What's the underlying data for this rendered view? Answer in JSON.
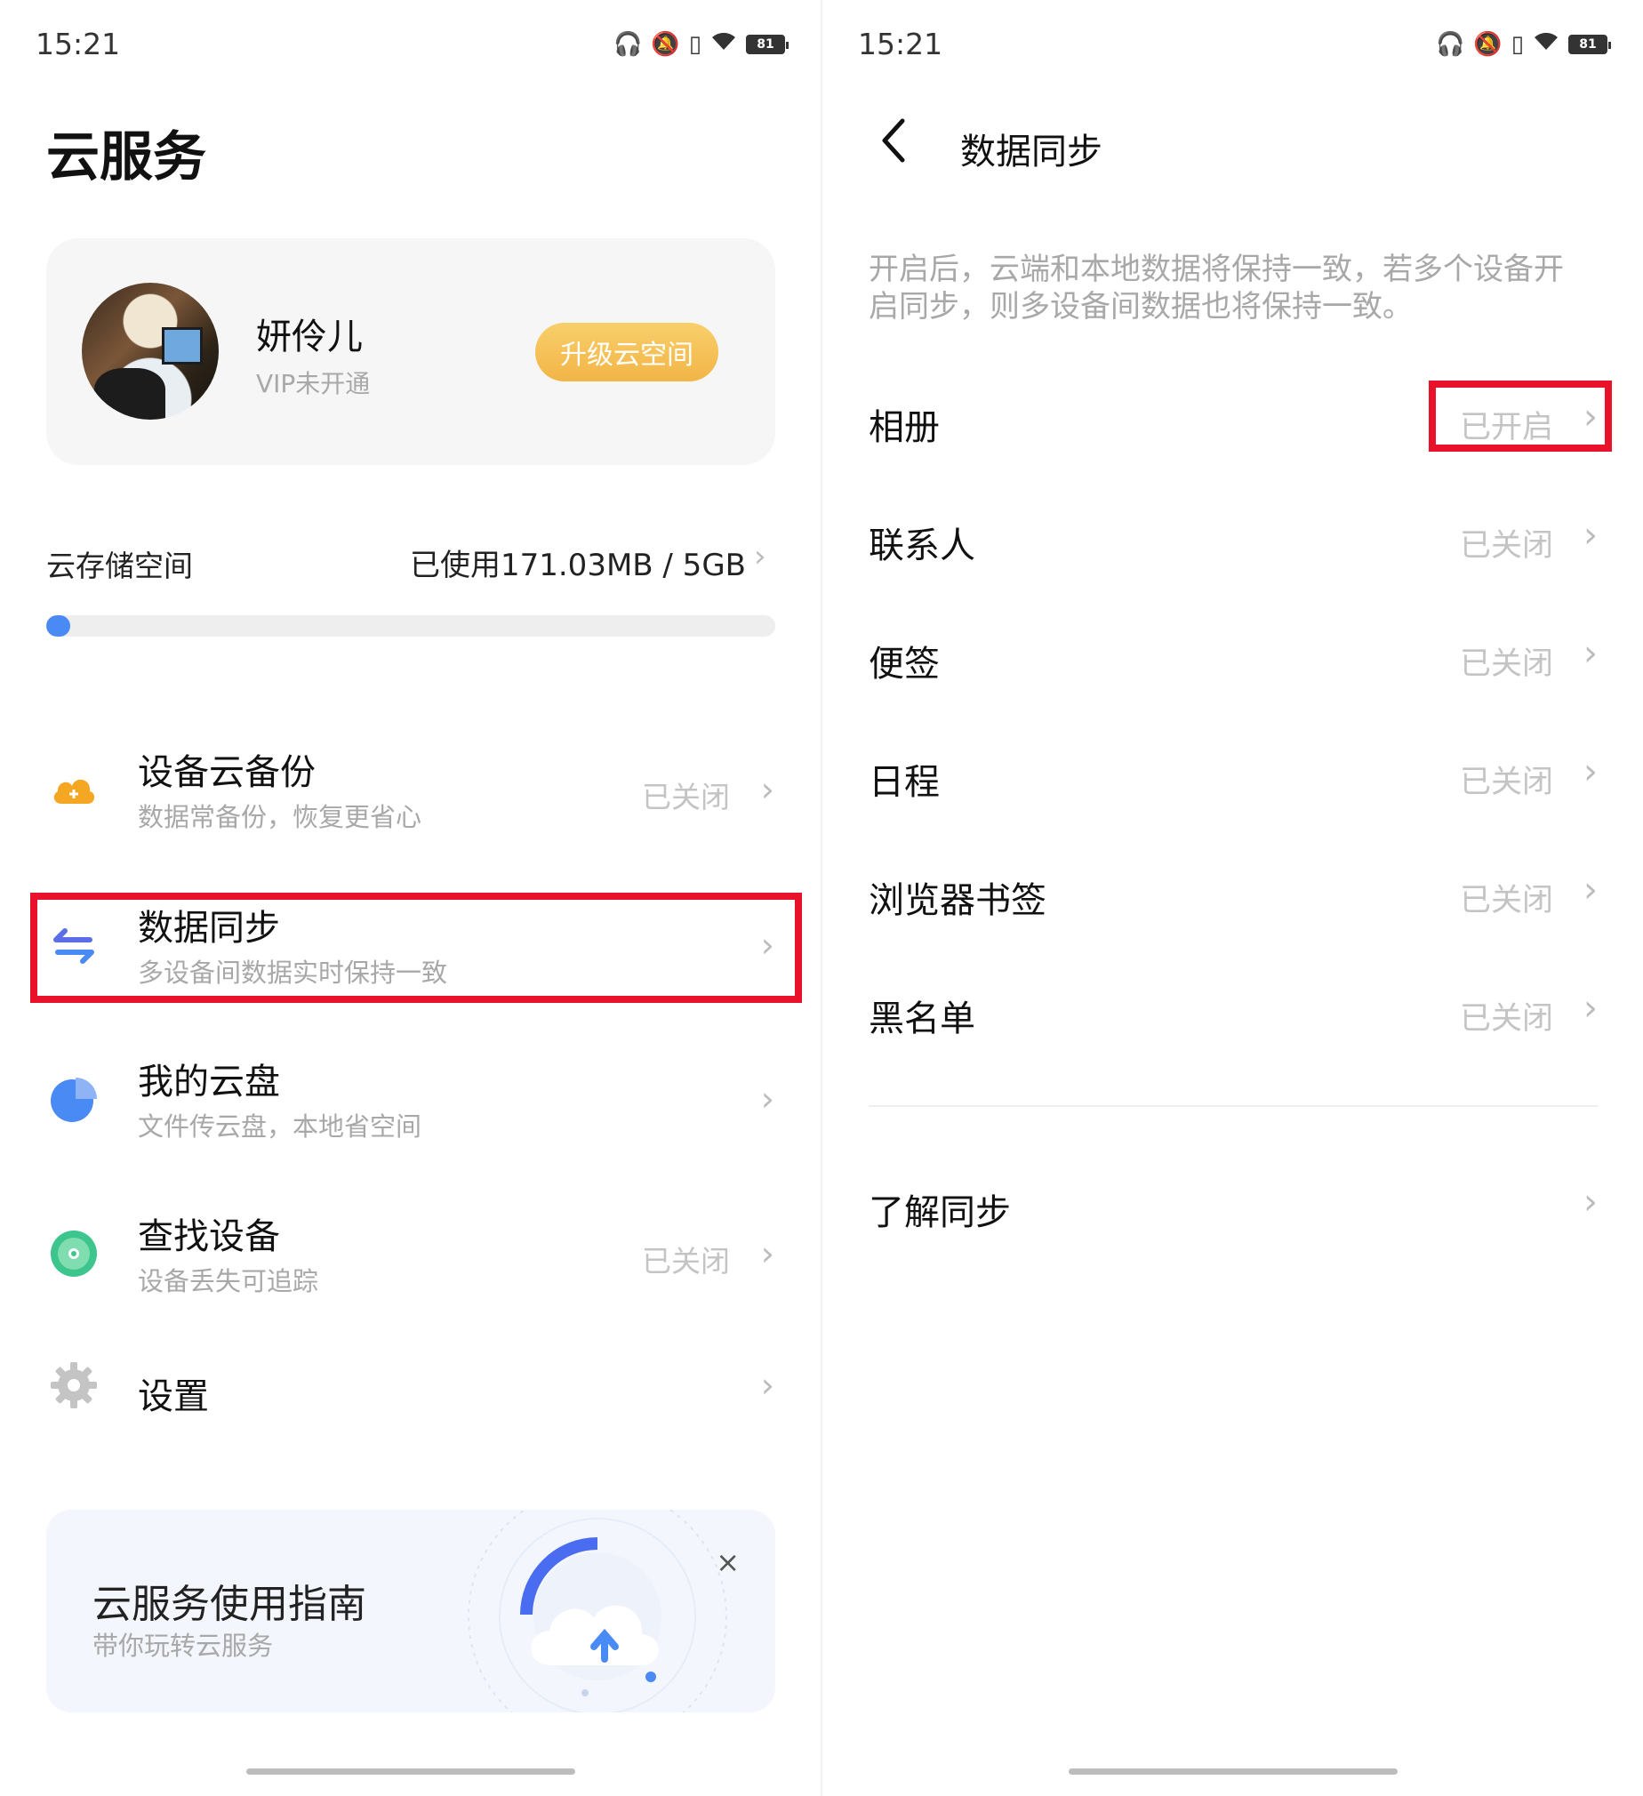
{
  "status_bar": {
    "time": "15:21",
    "battery": "81"
  },
  "left": {
    "title": "云服务",
    "account": {
      "name": "妍伶儿",
      "vip_status": "VIP未开通",
      "upgrade_label": "升级云空间"
    },
    "storage": {
      "label": "云存储空间",
      "usage": "已使用171.03MB / 5GB",
      "used_fraction": 0.033
    },
    "menu": [
      {
        "title": "设备云备份",
        "subtitle": "数据常备份，恢复更省心",
        "state": "已关闭",
        "icon": "cloud-plus-icon"
      },
      {
        "title": "数据同步",
        "subtitle": "多设备间数据实时保持一致",
        "state": "",
        "icon": "sync-arrows-icon"
      },
      {
        "title": "我的云盘",
        "subtitle": "文件传云盘，本地省空间",
        "state": "",
        "icon": "cloud-disk-icon"
      },
      {
        "title": "查找设备",
        "subtitle": "设备丢失可追踪",
        "state": "已关闭",
        "icon": "locate-icon"
      },
      {
        "title": "设置",
        "subtitle": "",
        "state": "",
        "icon": "gear-icon"
      }
    ],
    "guide": {
      "title": "云服务使用指南",
      "subtitle": "带你玩转云服务",
      "close": "×"
    }
  },
  "right": {
    "title": "数据同步",
    "description": "开启后，云端和本地数据将保持一致，若多个设备开启同步，则多设备间数据也将保持一致。",
    "items": [
      {
        "label": "相册",
        "state": "已开启"
      },
      {
        "label": "联系人",
        "state": "已关闭"
      },
      {
        "label": "便签",
        "state": "已关闭"
      },
      {
        "label": "日程",
        "state": "已关闭"
      },
      {
        "label": "浏览器书签",
        "state": "已关闭"
      },
      {
        "label": "黑名单",
        "state": "已关闭"
      }
    ],
    "learn_more": "了解同步"
  },
  "colors": {
    "accent_blue": "#4a8af4",
    "highlight_red": "#e8122a",
    "upgrade_gold": "#f2b547"
  }
}
